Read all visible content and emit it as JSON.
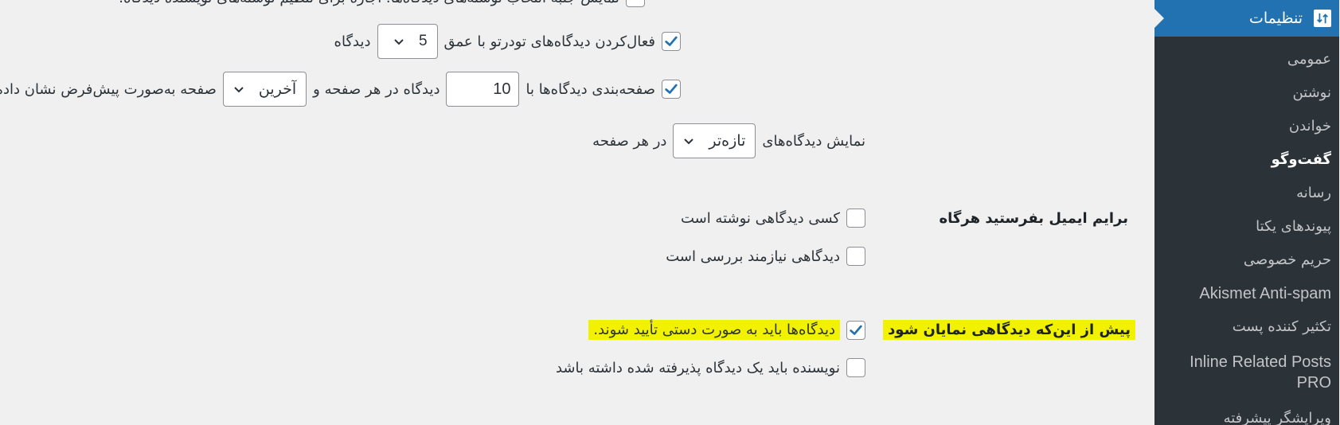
{
  "sidebar": {
    "header": {
      "label": "تنظیمات",
      "icon": "settings-sliders-icon"
    },
    "items": [
      {
        "label": "عمومی",
        "current": false
      },
      {
        "label": "نوشتن",
        "current": false
      },
      {
        "label": "خواندن",
        "current": false
      },
      {
        "label": "گفت‌وگو",
        "current": true
      },
      {
        "label": "رسانه",
        "current": false
      },
      {
        "label": "پیوندهای یکتا",
        "current": false
      },
      {
        "label": "حریم خصوصی",
        "current": false
      },
      {
        "label": "Akismet Anti-spam",
        "current": false
      },
      {
        "label": "تکثیر کننده پست",
        "current": false
      },
      {
        "label": "Inline Related Posts",
        "label_line2": "PRO",
        "current": false
      },
      {
        "label": "ویرایشگر پیشرفته",
        "current": false
      }
    ]
  },
  "discussion": {
    "cut_off_text": "نمایش جنبه انتخاب نوشته‌های دیدگاه‌ها. اجازه برای تنظیم نوشته‌های نویسنده دیدگاه.",
    "threaded": {
      "checked": true,
      "label_before": "فعال‌کردن دیدگاه‌های تودرتو با عمق",
      "depth_value": "5",
      "label_after": "دیدگاه"
    },
    "paging": {
      "checked": true,
      "label_before": "صفحه‌بندی دیدگاه‌ها با",
      "per_page_value": "10",
      "label_middle": "دیدگاه در هر صفحه و",
      "default_page_value": "آخرین",
      "label_after": "صفحه به‌صورت پیش‌فرض نشان داده‌شود."
    },
    "order": {
      "label_before": "نمایش دیدگاه‌های",
      "order_value": "تازه‌تر",
      "label_after": "در هر صفحه"
    },
    "email_me": {
      "heading": "برایم ایمیل بفرستید هرگاه",
      "options": [
        {
          "label": "کسی دیدگاهی نوشته است",
          "checked": false
        },
        {
          "label": "دیدگاهی نیازمند بررسی است",
          "checked": false
        }
      ]
    },
    "before_appears": {
      "heading": "پیش از این‌که دیدگاهی نمایان شود",
      "options": [
        {
          "label": "دیدگاه‌ها باید به صورت دستی تأیید شوند.",
          "checked": true,
          "highlighted": true
        },
        {
          "label": "نویسنده باید یک دیدگاه پذیرفته شده داشته باشد",
          "checked": false,
          "highlighted": false
        }
      ]
    },
    "highlight_color": "#f2f200",
    "accent_color": "#2271b1"
  }
}
